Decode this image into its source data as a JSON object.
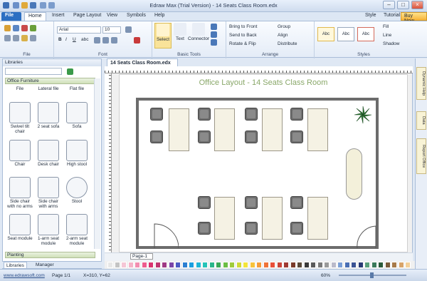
{
  "window": {
    "title": "Edraw Max (Trial Version) - 14 Seats Class Room.edx"
  },
  "menu": {
    "tabs": [
      "File",
      "Home",
      "Insert",
      "Page Layout",
      "View",
      "Symbols",
      "Help"
    ],
    "right": {
      "style": "Style",
      "tutorial": "Tutorial",
      "buy": "Buy Now"
    }
  },
  "ribbon": {
    "file_label": "File",
    "font": {
      "name": "Arial",
      "size": "10",
      "label": "Font"
    },
    "basic_tools": {
      "select": "Select",
      "text": "Text",
      "connector": "Connector",
      "label": "Basic Tools"
    },
    "arrange": {
      "bring_front": "Bring to Front",
      "send_back": "Send to Back",
      "rotate": "Rotate & Flip",
      "group": "Group",
      "align": "Align",
      "distribute": "Distribute",
      "label": "Arrange"
    },
    "styles": {
      "items": [
        "Abc",
        "Abc",
        "Abc"
      ],
      "fill": "Fill",
      "line": "Line",
      "shadow": "Shadow",
      "label": "Styles"
    }
  },
  "library": {
    "header": "Libraries",
    "category": "Office Furniture",
    "top_row": [
      "File",
      "Lateral file",
      "Flat file"
    ],
    "shapes": [
      [
        "Swivel tilt chair",
        "2 seat sofa",
        "Sofa"
      ],
      [
        "Chair",
        "Desk chair",
        "High stool"
      ],
      [
        "Side chair with no arms",
        "Side chair with arms",
        "Stool"
      ],
      [
        "Seat module",
        "1-arm seat module",
        "2-arm seat module"
      ]
    ],
    "category2": "Planting",
    "tabs": [
      "Libraries",
      "Manager"
    ]
  },
  "document": {
    "tab": "14 Seats Class Room.edx",
    "plan_title": "Office Layout - 14 Seats Class Room",
    "page_tab": "Page-1"
  },
  "right_panel": [
    "Dynamic Help",
    "Data",
    "Report Office"
  ],
  "status": {
    "site": "www.edrawsoft.com",
    "page": "Page 1/1",
    "coords": "X=310, Y=62",
    "zoom": "60%"
  },
  "palette": [
    "#e7e7e7",
    "#c4c4c4",
    "#f5c6d5",
    "#f5b3c8",
    "#f28fb1",
    "#ed5c8e",
    "#d9336f",
    "#bf3570",
    "#9f3a84",
    "#7a46a8",
    "#4c5cc4",
    "#2b7fd1",
    "#1a9ee0",
    "#1eb5d6",
    "#25c3b8",
    "#29b58a",
    "#3aa857",
    "#6bbd45",
    "#9fcb3a",
    "#cfd837",
    "#f3e43a",
    "#f7c23b",
    "#f59c3a",
    "#ef7339",
    "#e8503a",
    "#c9463a",
    "#9f3a33",
    "#7a3a2a",
    "#5a4a3a",
    "#3a3a3a",
    "#5a5a5a",
    "#7a7a7a",
    "#9a9a9a",
    "#babaca",
    "#7b9fd6",
    "#4a6fb4",
    "#3b5394",
    "#2a3a74",
    "#5a9f7a",
    "#3a7a5a",
    "#2a5a3a",
    "#7a5a3a",
    "#a77a4a",
    "#d8a46a",
    "#f3d09a"
  ]
}
